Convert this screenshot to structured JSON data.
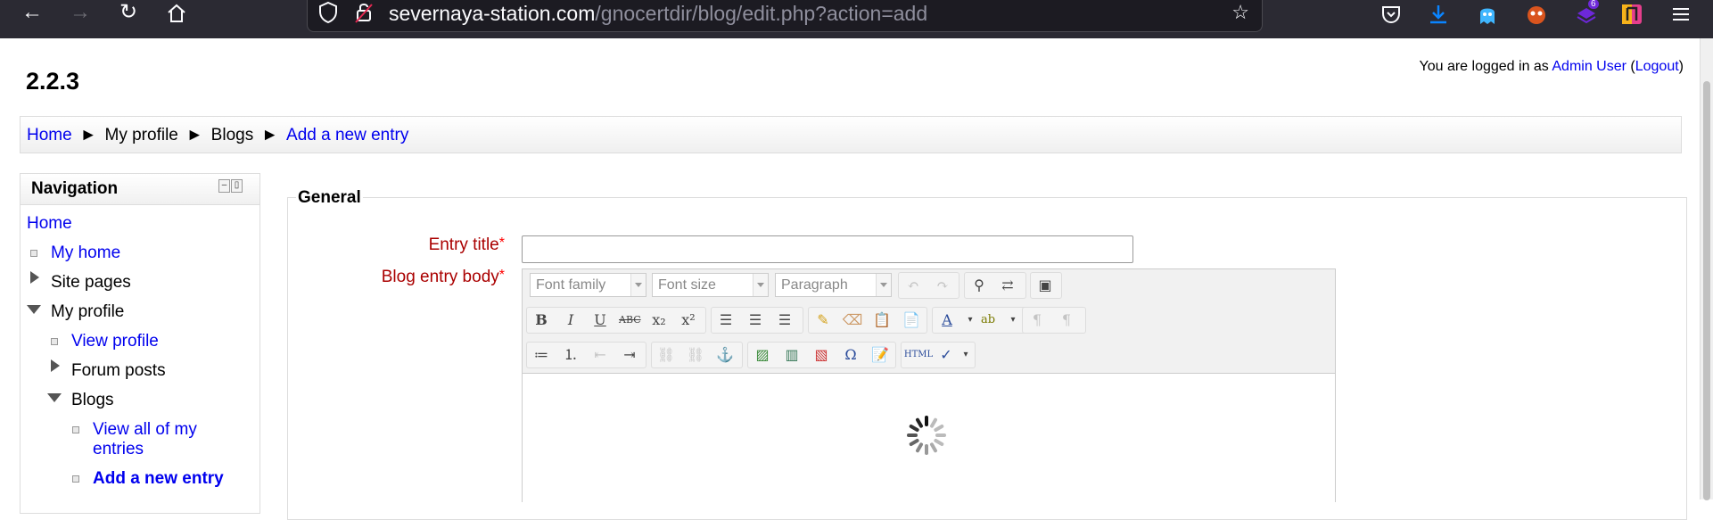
{
  "browser": {
    "url_domain": "severnaya-station.com",
    "url_path": "/gnocertdir/blog/edit.php?action=add",
    "notification_badge": "6"
  },
  "header": {
    "version": "2.2.3",
    "login_prefix": "You are logged in as ",
    "user_name": "Admin User",
    "logout_open": "(",
    "logout_label": "Logout",
    "logout_close": ")"
  },
  "breadcrumb": {
    "items": [
      "Home",
      "My profile",
      "Blogs",
      "Add a new entry"
    ],
    "separator": "►"
  },
  "navigation": {
    "title": "Navigation",
    "items": {
      "home": "Home",
      "my_home": "My home",
      "site_pages": "Site pages",
      "my_profile": "My profile",
      "view_profile": "View profile",
      "forum_posts": "Forum posts",
      "blogs": "Blogs",
      "view_all_entries_line1": "View all of my",
      "view_all_entries_line2": "entries",
      "add_new_entry": "Add a new entry"
    }
  },
  "form": {
    "legend": "General",
    "entry_title_label": "Entry title",
    "body_label": "Blog entry body",
    "required_marker": "*",
    "entry_title_value": ""
  },
  "editor": {
    "font_family": "Font family",
    "font_size": "Font size",
    "paragraph": "Paragraph",
    "buttons": {
      "bold": "B",
      "italic": "I",
      "underline": "U",
      "strike": "ABC",
      "subscript": "x₂",
      "superscript": "x²",
      "omega": "Ω",
      "html": "HTML"
    }
  },
  "colors": {
    "link": "#0000ee",
    "required_label": "#aa0000",
    "browser_chrome": "#2b2a33"
  }
}
